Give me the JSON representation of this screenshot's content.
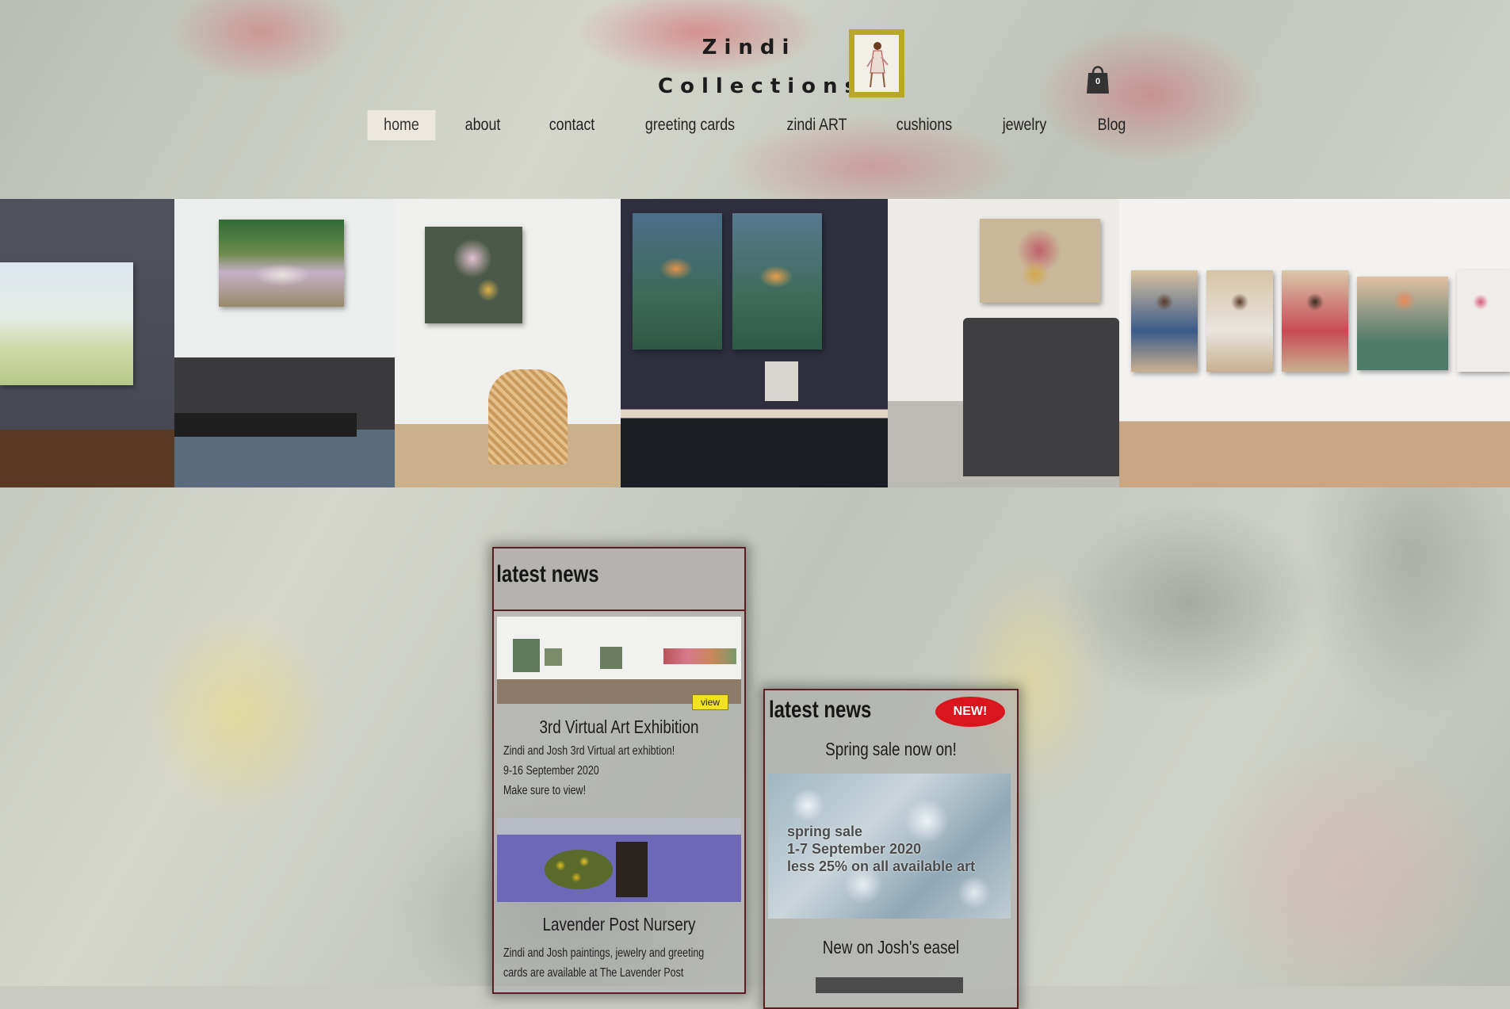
{
  "brand": {
    "line1": "Zindi",
    "line2": "Collections"
  },
  "cart": {
    "count": "0"
  },
  "nav": {
    "items": [
      {
        "label": "home",
        "active": true
      },
      {
        "label": "about"
      },
      {
        "label": "contact"
      },
      {
        "label": "greeting cards"
      },
      {
        "label": "zindi ART"
      },
      {
        "label": "cushions"
      },
      {
        "label": "jewelry"
      },
      {
        "label": "Blog"
      }
    ]
  },
  "news_main": {
    "title": "latest news",
    "cards": [
      {
        "title": "3rd Virtual Art Exhibition",
        "badge": "view",
        "lines": [
          "Zindi and Josh 3rd Virtual art exhibtion!",
          "9-16 September 2020",
          "Make sure to view!"
        ]
      },
      {
        "title": "Lavender Post Nursery",
        "lines": [
          "Zindi and Josh paintings, jewelry and greeting",
          "cards are available at The Lavender Post"
        ]
      }
    ]
  },
  "news_side": {
    "title": "latest news",
    "badge": "NEW!",
    "headline": "Spring sale now on!",
    "sale_lines": [
      "spring sale",
      "1-7 September 2020",
      "less 25% on all available art"
    ],
    "footer": "New on Josh's easel"
  },
  "colors": {
    "accent_border": "#5b1f23",
    "badge_red": "#d9151e",
    "badge_yellow": "#f2e222",
    "logo_frame": "#b7a72a"
  },
  "icons": [
    "shopping-bag-icon"
  ]
}
